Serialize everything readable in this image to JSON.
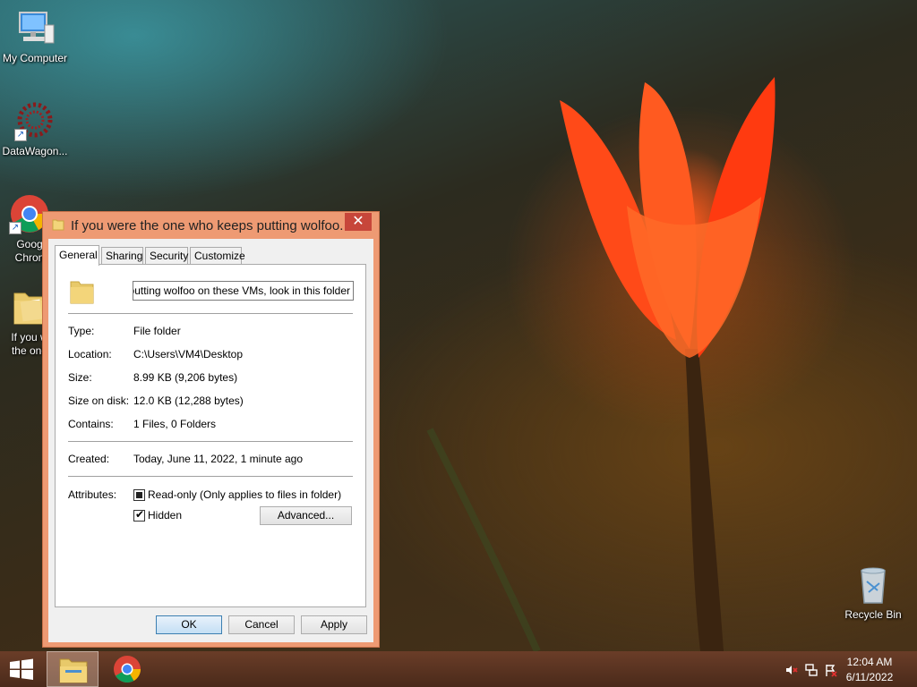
{
  "desktop": {
    "icons": [
      {
        "label": "My Computer"
      },
      {
        "label": "DataWagon..."
      },
      {
        "label": "Goog Chron"
      },
      {
        "label": "If you w the one"
      },
      {
        "label": "Recycle Bin"
      }
    ]
  },
  "dialog": {
    "title": "If you were the one who keeps putting wolfoo...",
    "close_label": "✕",
    "tabs": [
      {
        "label": "General"
      },
      {
        "label": "Sharing"
      },
      {
        "label": "Security"
      },
      {
        "label": "Customize"
      }
    ],
    "name_value": "eps putting wolfoo on these VMs, look in this folder",
    "properties": {
      "type_label": "Type:",
      "type_value": "File folder",
      "location_label": "Location:",
      "location_value": "C:\\Users\\VM4\\Desktop",
      "size_label": "Size:",
      "size_value": "8.99 KB (9,206 bytes)",
      "size_on_disk_label": "Size on disk:",
      "size_on_disk_value": "12.0 KB (12,288 bytes)",
      "contains_label": "Contains:",
      "contains_value": "1 Files, 0 Folders",
      "created_label": "Created:",
      "created_value": "Today, June 11, 2022, 1 minute ago",
      "attributes_label": "Attributes:"
    },
    "attributes": {
      "readonly_label": "Read-only (Only applies to files in folder)",
      "readonly_state": "indeterminate",
      "hidden_label": "Hidden",
      "hidden_checked": true,
      "advanced_label": "Advanced..."
    },
    "buttons": {
      "ok": "OK",
      "cancel": "Cancel",
      "apply": "Apply"
    }
  },
  "taskbar": {
    "clock_time": "12:04 AM",
    "clock_date": "6/11/2022"
  },
  "colors": {
    "dialog_frame": "#ee9a73",
    "close_button": "#c7463a",
    "taskbar": "#5a3322"
  }
}
